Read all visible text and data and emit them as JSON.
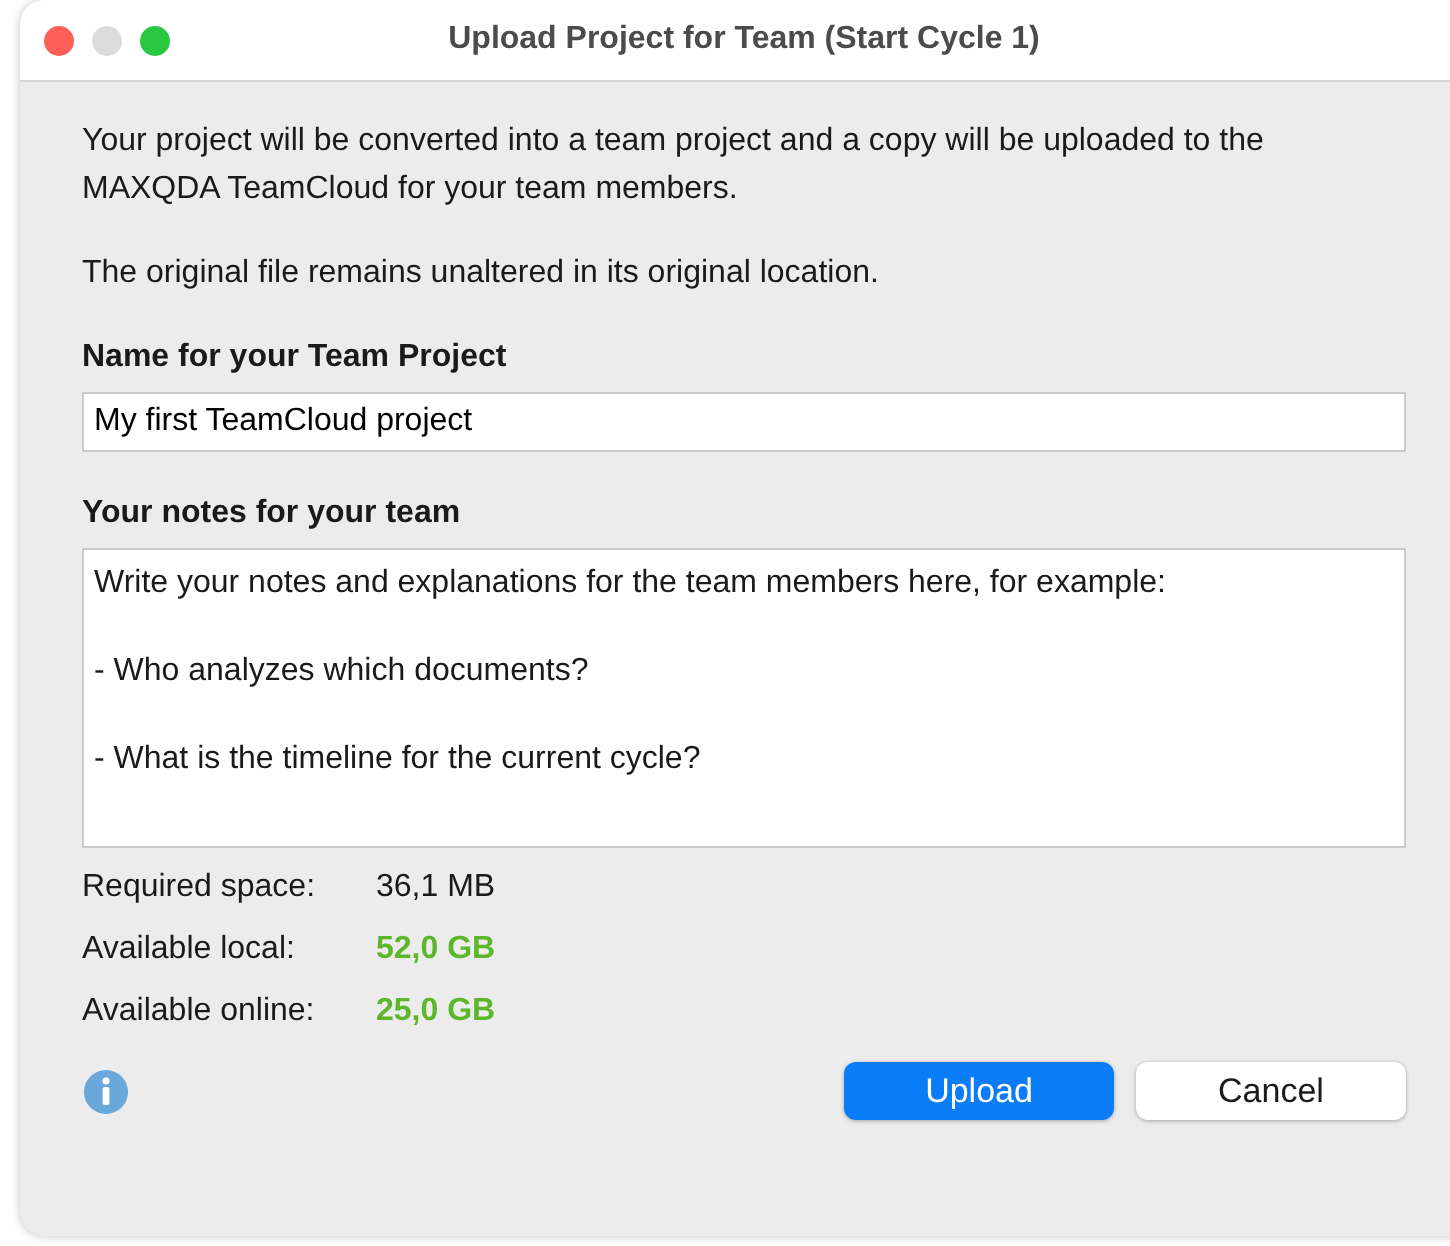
{
  "window": {
    "title": "Upload Project for Team (Start Cycle 1)"
  },
  "intro": [
    "Your project will be converted into a team project and a copy will be uploaded to the MAXQDA TeamCloud for your team members.",
    "The original file remains unaltered in its original location."
  ],
  "name_field": {
    "label": "Name for your Team Project",
    "value": "My first TeamCloud project"
  },
  "notes_field": {
    "label": "Your notes for your team",
    "value": "Write your notes and explanations for the team members here, for example:\n\n- Who analyzes which documents?\n\n- What is the timeline for the current cycle?"
  },
  "stats": [
    {
      "label": "Required space:",
      "value": "36,1 MB",
      "kind": "plain"
    },
    {
      "label": "Available local:",
      "value": "52,0 GB",
      "kind": "ok"
    },
    {
      "label": "Available online:",
      "value": "25,0 GB",
      "kind": "ok"
    }
  ],
  "buttons": [
    {
      "label": "Upload",
      "kind": "default"
    },
    {
      "label": "Cancel",
      "kind": "normal"
    }
  ]
}
